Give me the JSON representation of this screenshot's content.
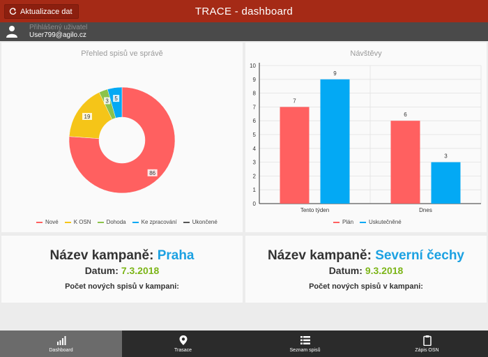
{
  "header": {
    "refresh_label": "Aktualizace dat",
    "title": "TRACE - dashboard"
  },
  "user": {
    "caption": "Přihlášený uživatel",
    "email": "User799@agilo.cz"
  },
  "colors": {
    "header": "#a52a16",
    "red": "#ff6060",
    "yellow": "#f5c518",
    "green": "#8bc34a",
    "blue": "#03a9f4",
    "gray": "#555555"
  },
  "chart_data": [
    {
      "type": "pie",
      "title": "Přehled spisů ve správě",
      "labels": [
        "Nové",
        "K OSN",
        "Dohoda",
        "Ke zpracování",
        "Ukončené"
      ],
      "values": [
        86,
        19,
        3,
        5,
        0
      ],
      "colors": [
        "#ff6060",
        "#f5c518",
        "#8bc34a",
        "#03a9f4",
        "#555555"
      ],
      "donut": true,
      "legend": "bottom"
    },
    {
      "type": "bar",
      "title": "Návštěvy",
      "categories": [
        "Tento týden",
        "Dnes"
      ],
      "series": [
        {
          "name": "Plán",
          "values": [
            7,
            6
          ],
          "color": "#ff6060"
        },
        {
          "name": "Uskutečněné",
          "values": [
            9,
            3
          ],
          "color": "#03a9f4"
        }
      ],
      "yticks": [
        0,
        1,
        2,
        3,
        4,
        5,
        6,
        7,
        8,
        9,
        10
      ],
      "ylim": [
        0,
        10
      ],
      "grid": true,
      "legend": "bottom"
    }
  ],
  "campaigns": [
    {
      "label": "Název kampaně:",
      "name": "Praha",
      "date_label": "Datum:",
      "date": "7.3.2018",
      "count_label": "Počet nových spisů v kampani:"
    },
    {
      "label": "Název kampaně:",
      "name": "Severní čechy",
      "date_label": "Datum:",
      "date": "9.3.2018",
      "count_label": "Počet nových spisů v kampani:"
    }
  ],
  "nav": [
    {
      "label": "Dashboard",
      "icon": "bar-chart-icon",
      "active": true
    },
    {
      "label": "Trasace",
      "icon": "map-pin-icon",
      "active": false
    },
    {
      "label": "Seznam spisů",
      "icon": "list-icon",
      "active": false
    },
    {
      "label": "Zápis OSN",
      "icon": "clipboard-icon",
      "active": false
    }
  ]
}
